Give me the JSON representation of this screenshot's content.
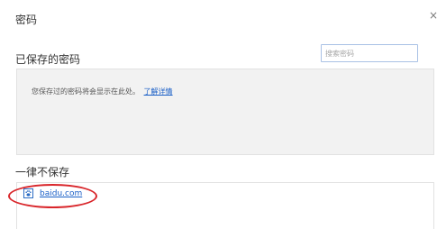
{
  "dialog": {
    "title": "密码",
    "close_glyph": "×"
  },
  "saved": {
    "section_title": "已保存的密码",
    "search_placeholder": "搜索密码",
    "search_value": "",
    "empty_message": "您保存过的密码将会显示在此处。",
    "learn_more": "了解详情"
  },
  "never_saved": {
    "section_title": "一律不保存",
    "sites": [
      {
        "domain": "baidu.com",
        "icon": "baidu-paw-favicon"
      }
    ]
  },
  "annotation": {
    "highlight_color": "#d9262b"
  },
  "colors": {
    "link": "#1a5fc7",
    "panel_bg": "#f2f2f2",
    "search_border": "#a9c1e5"
  }
}
